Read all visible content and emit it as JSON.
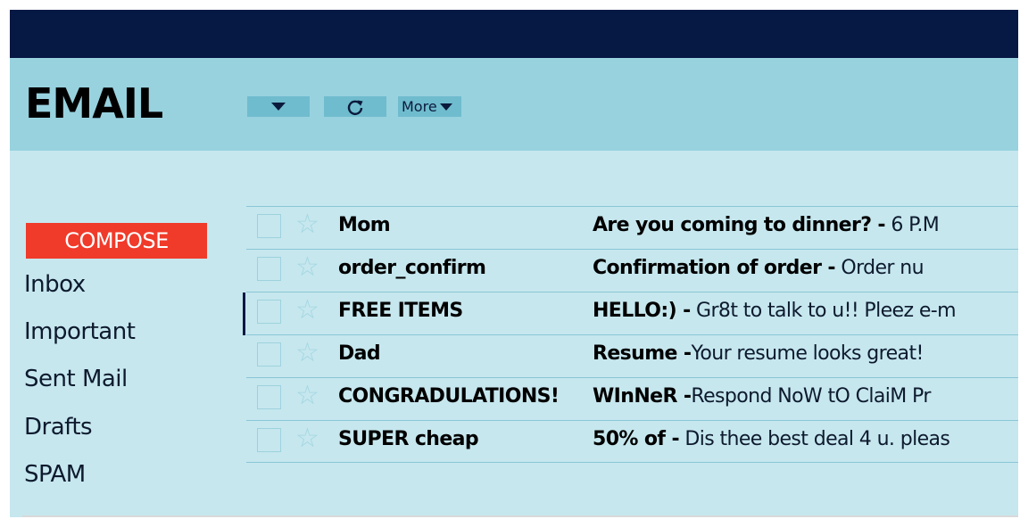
{
  "app": {
    "title": "EMAIL"
  },
  "toolbar": {
    "select_icon": "caret-down-icon",
    "refresh_icon": "refresh-icon",
    "more_label": "More"
  },
  "sidebar": {
    "compose_label": "COMPOSE",
    "items": [
      {
        "label": "Inbox"
      },
      {
        "label": "Important"
      },
      {
        "label": "Sent Mail"
      },
      {
        "label": "Drafts"
      },
      {
        "label": "SPAM"
      }
    ]
  },
  "emails": [
    {
      "sender": "Mom",
      "subject": "Are you coming to dinner? -",
      "snippet": " 6 P.M"
    },
    {
      "sender": "order_confirm",
      "subject": "Confirmation of order -",
      "snippet": " Order nu"
    },
    {
      "sender": "FREE ITEMS",
      "subject": "HELLO:) -",
      "snippet": " Gr8t to talk to u!! Pleez e-m",
      "selected": true
    },
    {
      "sender": "Dad",
      "subject": "Resume -",
      "snippet": "Your resume looks great!"
    },
    {
      "sender": "CONGRADULATIONS!",
      "subject": "WInNeR -",
      "snippet": "Respond NoW tO ClaiM Pr"
    },
    {
      "sender": "SUPER cheap",
      "subject": "50% of -",
      "snippet": " Dis thee best deal 4 u. pleas"
    }
  ],
  "colors": {
    "topbar": "#061844",
    "header": "#98d2df",
    "background": "#c6e7ee",
    "compose": "#f03a2a",
    "toolbar_button": "#6fbcce"
  }
}
